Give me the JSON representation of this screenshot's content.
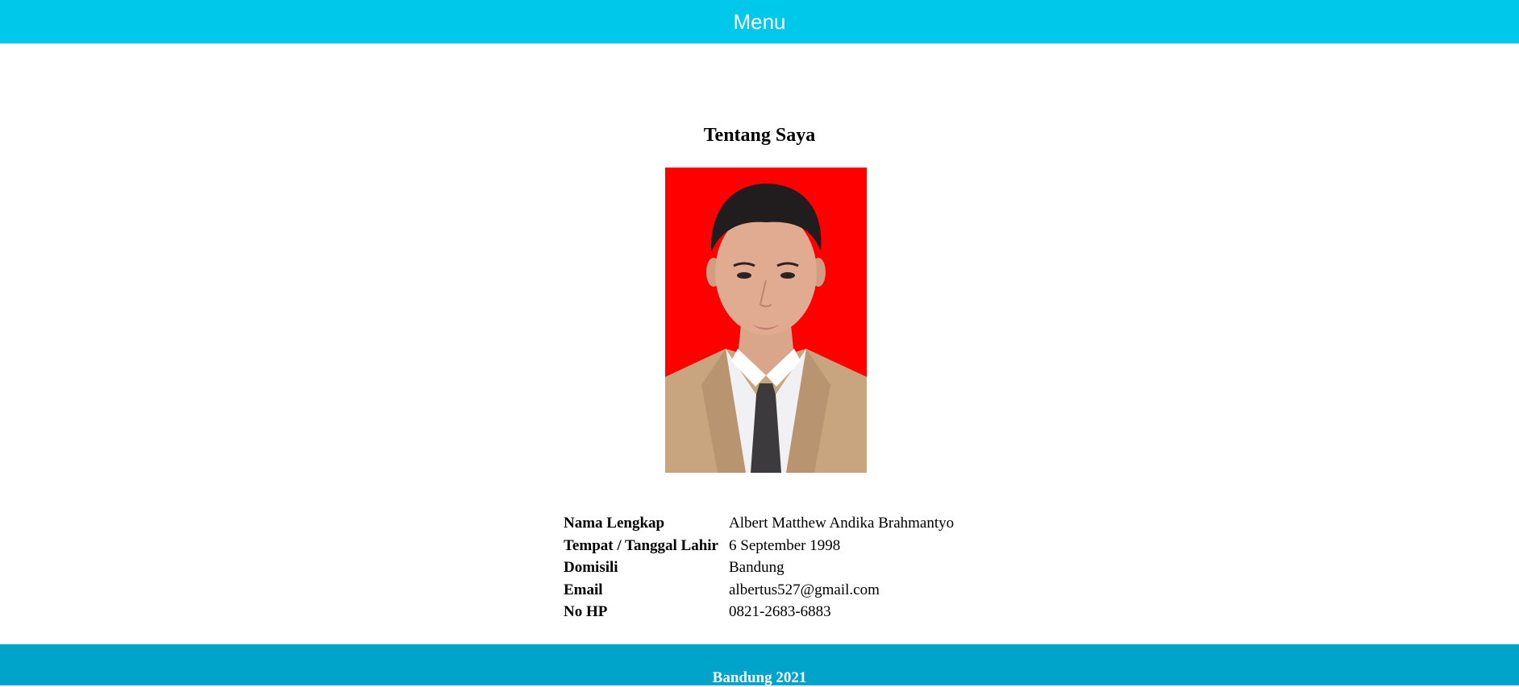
{
  "header": {
    "menu_label": "Menu",
    "background": "#00c8ea"
  },
  "main": {
    "title": "Tentang Saya",
    "photo_alt": "Profile photo",
    "photo_background": "#ff0000",
    "info": [
      {
        "label": "Nama Lengkap",
        "value": "Albert Matthew Andika Brahmantyo"
      },
      {
        "label": "Tempat / Tanggal Lahir",
        "value": "6 September 1998"
      },
      {
        "label": "Domisili",
        "value": "Bandung"
      },
      {
        "label": "Email",
        "value": "albertus527@gmail.com"
      },
      {
        "label": "No HP",
        "value": "0821-2683-6883"
      }
    ]
  },
  "footer": {
    "text": "Bandung 2021",
    "background": "#00a3c9"
  }
}
